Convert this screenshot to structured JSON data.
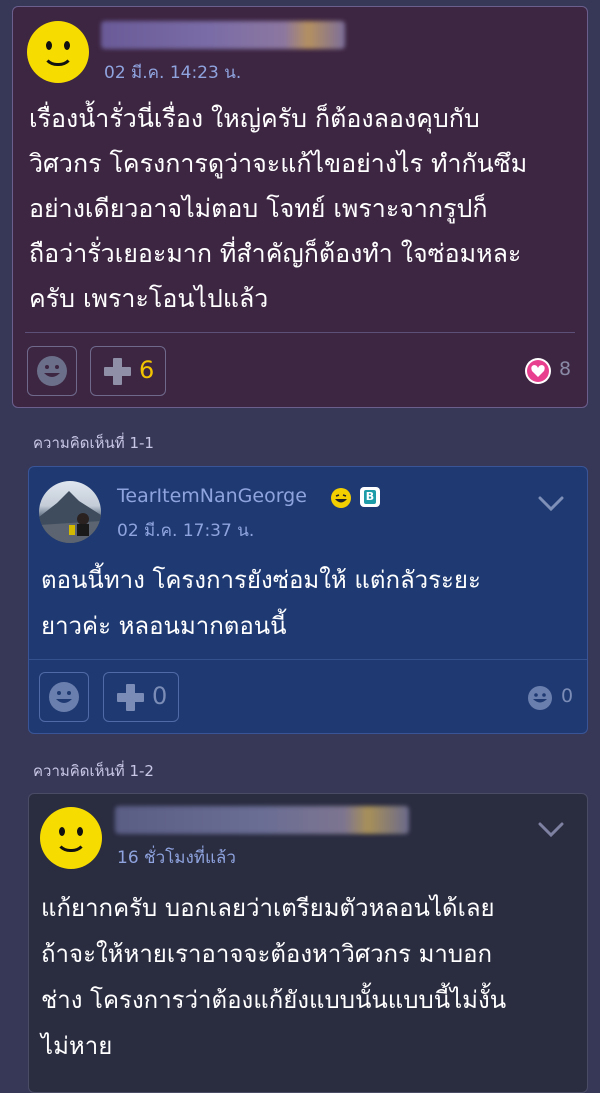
{
  "main_comment": {
    "time": "02 มี.ค. 14:23 น.",
    "body_lines": [
      "เรื่องน้ำรั่วนี่เรื่อง ใหญ่ครับ ก็ต้องลองคุบกับ",
      "วิศวกร โครงการดูว่าจะแก้ไขอย่างไร ทำกันซึม",
      "อย่างเดียวอาจไม่ตอบ โจทย์ เพราะจากรูปก็",
      "ถือว่ารั่วเยอะมาก ที่สำคัญก็ต้องทำ ใจซ่อมหละ",
      "ครับ เพราะโอนไปแล้ว"
    ],
    "plus_count": "6",
    "emotion_count": "8",
    "colors": {
      "plus_count": "#f2c300",
      "heart": "#e8408f"
    }
  },
  "reply_1": {
    "label": "ความคิดเห็นที่ 1-1",
    "name": "TearItemNanGeorge",
    "time": "02 มี.ค. 17:37 น.",
    "body_lines": [
      "ตอนนี้ทาง โครงการยังซ่อมให้ แต่กลัวระยะ",
      "ยาวค่ะ หลอนมากตอนนี้"
    ],
    "plus_count": "0",
    "emotion_count": "0",
    "badge": "B"
  },
  "reply_2": {
    "label": "ความคิดเห็นที่ 1-2",
    "time": "16 ชั่วโมงที่แล้ว",
    "body_lines": [
      "แก้ยากครับ บอกเลยว่าเตรียมตัวหลอนได้เลย",
      "ถ้าจะให้หายเราอาจจะต้องหาวิศวกร มาบอก",
      "ช่าง โครงการว่าต้องแก้ยังแบบนั้นแบบนี้ไม่งั้น",
      "ไม่หาย"
    ]
  }
}
